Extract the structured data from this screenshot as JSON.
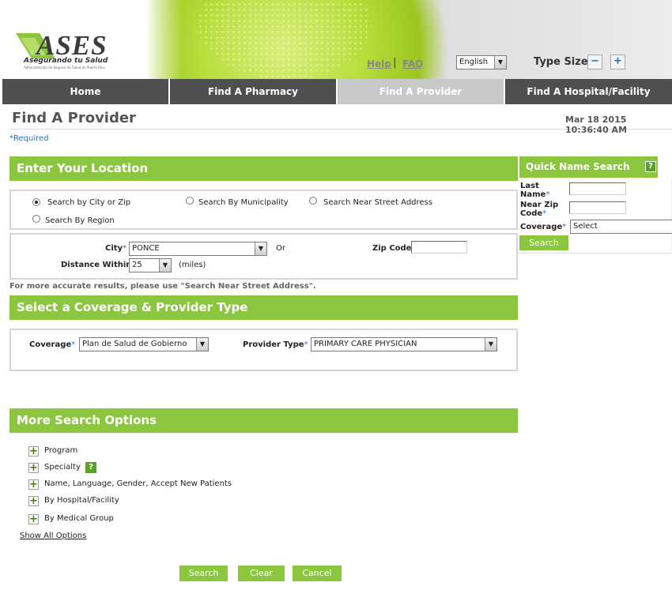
{
  "header": {
    "logo_text": "ASES",
    "logo_tagline": "Asegurando tu Salud",
    "logo_fineprint": "Administración de Seguros de Salud de Puerto Rico",
    "help_label": "Help",
    "separator": "|",
    "faq_label": "FAQ",
    "language_value": "English",
    "type_size_label": "Type Size:",
    "minus_label": "−",
    "plus_label": "+"
  },
  "nav": {
    "tabs": [
      {
        "label": "Home"
      },
      {
        "label": "Find A Pharmacy"
      },
      {
        "label": "Find A Provider",
        "active": true
      },
      {
        "label": "Find A Hospital/Facility"
      }
    ]
  },
  "page": {
    "title": "Find A Provider",
    "datetime": "Mar 18 2015 10:36:40 AM",
    "required_note": "*Required"
  },
  "location": {
    "header": "Enter Your Location",
    "radios": [
      {
        "label": "Search by City or Zip",
        "checked": true
      },
      {
        "label": "Search By Municipality",
        "checked": false
      },
      {
        "label": "Search Near Street Address",
        "checked": false
      },
      {
        "label": "Search By Region",
        "checked": false
      }
    ],
    "city_label": "City",
    "required_mark": "*",
    "city_value": "PONCE",
    "or_label": "Or",
    "zip_label": "Zip Code",
    "zip_value": "",
    "distance_label": "Distance Within",
    "distance_value": "25",
    "miles_label": "(miles)",
    "note": "For more accurate results, please use \"Search Near Street Address\"."
  },
  "coverage": {
    "header": "Select a Coverage & Provider Type",
    "coverage_label": "Coverage",
    "coverage_value": "Plan de Salud de Gobierno",
    "provider_type_label": "Provider Type",
    "provider_type_value": "PRIMARY CARE PHYSICIAN"
  },
  "more_options": {
    "header": "More Search Options",
    "items": [
      {
        "label": "Program"
      },
      {
        "label": "Specialty"
      },
      {
        "label": "Name, Language, Gender, Accept New Patients"
      },
      {
        "label": "By Hospital/Facility"
      },
      {
        "label": "By Medical Group"
      }
    ],
    "show_all": "Show All Options",
    "expand_symbol": "+",
    "help_symbol": "?"
  },
  "quick_search": {
    "header": "Quick Name Search",
    "last_name_label": "Last Name",
    "near_zip_label": "Near Zip Code",
    "coverage_label": "Coverage",
    "coverage_value": "Select",
    "search_button": "Search"
  },
  "actions": {
    "search": "Search",
    "clear": "Clear",
    "cancel": "Cancel"
  },
  "colors": {
    "accent_green": "#8cc63f",
    "nav_gray": "#4f4f4f",
    "active_tab": "#c9c9c9",
    "required_blue": "#2a6fb3"
  }
}
